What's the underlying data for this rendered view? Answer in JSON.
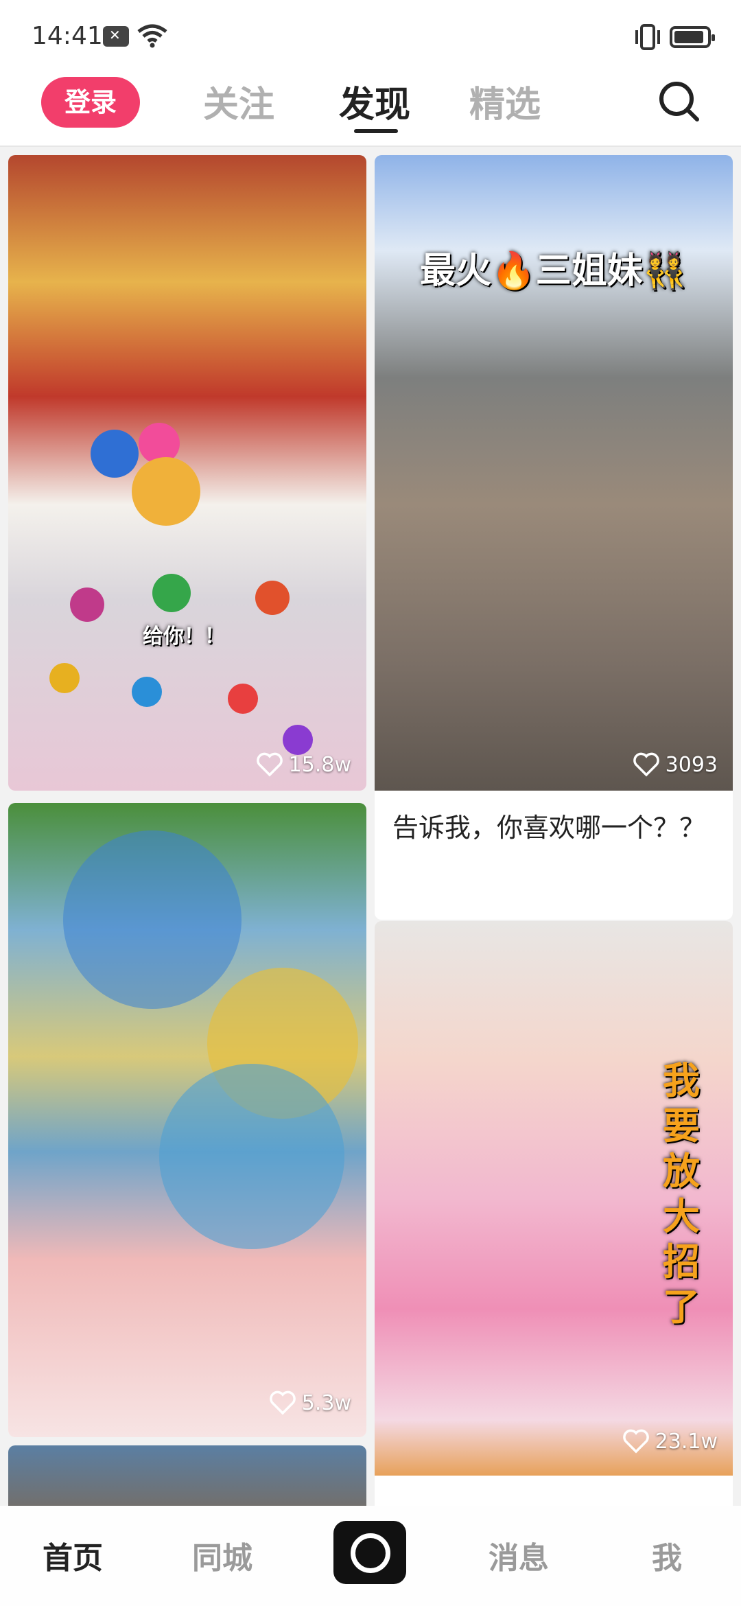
{
  "status_bar": {
    "time": "14:41"
  },
  "top_nav": {
    "login_label": "登录",
    "tabs": [
      {
        "label": "关注",
        "active": false
      },
      {
        "label": "发现",
        "active": true
      },
      {
        "label": "精选",
        "active": false
      }
    ],
    "search_icon": "search-icon"
  },
  "feed": {
    "cards": [
      {
        "overlay_text": "给你！！",
        "likes": "15.8w",
        "title": ""
      },
      {
        "overlay_text": "最火🔥三姐妹👯",
        "likes": "3093",
        "title": "告诉我，你喜欢哪一个？？"
      },
      {
        "overlay_text": "",
        "likes": "5.3w",
        "title": ""
      },
      {
        "overlay_text": "我要放大招了",
        "likes": "23.1w",
        "title": ""
      }
    ]
  },
  "bottom_bar": {
    "tabs": [
      {
        "label": "首页",
        "active": true
      },
      {
        "label": "同城",
        "active": false
      },
      {
        "label": "消息",
        "active": false
      },
      {
        "label": "我",
        "active": false
      }
    ],
    "record_icon": "record-icon"
  },
  "colors": {
    "accent": "#f23e6b",
    "active_text": "#222222",
    "inactive_text": "#b0b0b0"
  }
}
